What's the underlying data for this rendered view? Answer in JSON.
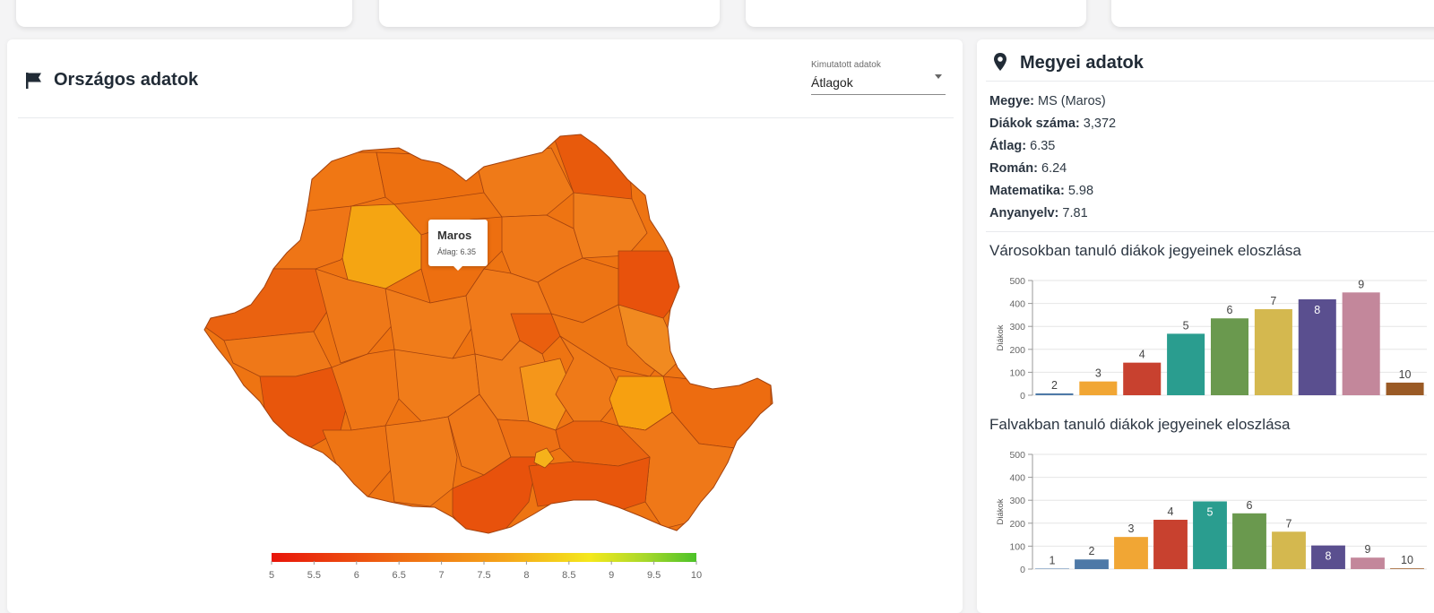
{
  "left_panel": {
    "title": "Országos adatok",
    "select": {
      "label": "Kimutatott adatok",
      "value": "Átlagok"
    },
    "tooltip": {
      "name": "Maros",
      "line": "Átlag: 6.35"
    },
    "legend_ticks": [
      "5",
      "5.5",
      "6",
      "6.5",
      "7",
      "7.5",
      "8",
      "8.5",
      "9",
      "9.5",
      "10"
    ]
  },
  "right_panel": {
    "title": "Megyei adatok",
    "info": [
      {
        "label": "Megye:",
        "value": "MS (Maros)"
      },
      {
        "label": "Diákok száma:",
        "value": "3,372"
      },
      {
        "label": "Átlag:",
        "value": "6.35"
      },
      {
        "label": "Román:",
        "value": "6.24"
      },
      {
        "label": "Matematika:",
        "value": "5.98"
      },
      {
        "label": "Anyanyelv:",
        "value": "7.81"
      }
    ],
    "city_title": "Városokban tanuló diákok jegyeinek eloszlása",
    "village_title": "Falvakban tanuló diákok jegyeinek eloszlása"
  },
  "colors": {
    "grades": [
      "#4e79a7",
      "#f1a634",
      "#c8412f",
      "#2a9d8f",
      "#6a994e",
      "#d4b84f",
      "#5a4f8f",
      "#c3879b",
      "#9a5a25"
    ]
  },
  "chart_data": [
    {
      "type": "bar",
      "title": "Városokban tanuló diákok jegyeinek eloszlása",
      "ylabel": "Diákok",
      "ylim": [
        0,
        500
      ],
      "yticks": [
        0,
        100,
        200,
        300,
        400,
        500
      ],
      "categories": [
        "2",
        "3",
        "4",
        "5",
        "6",
        "7",
        "8",
        "9",
        "10"
      ],
      "values": [
        8,
        60,
        142,
        268,
        335,
        375,
        418,
        448,
        55
      ]
    },
    {
      "type": "bar",
      "title": "Falvakban tanuló diákok jegyeinek eloszlása",
      "ylabel": "Diákok",
      "ylim": [
        0,
        500
      ],
      "yticks": [
        0,
        100,
        200,
        300,
        400,
        500
      ],
      "categories": [
        "1",
        "2",
        "3",
        "4",
        "5",
        "6",
        "7",
        "8",
        "9",
        "10"
      ],
      "values": [
        2,
        42,
        140,
        215,
        295,
        243,
        163,
        103,
        50,
        3
      ]
    }
  ]
}
